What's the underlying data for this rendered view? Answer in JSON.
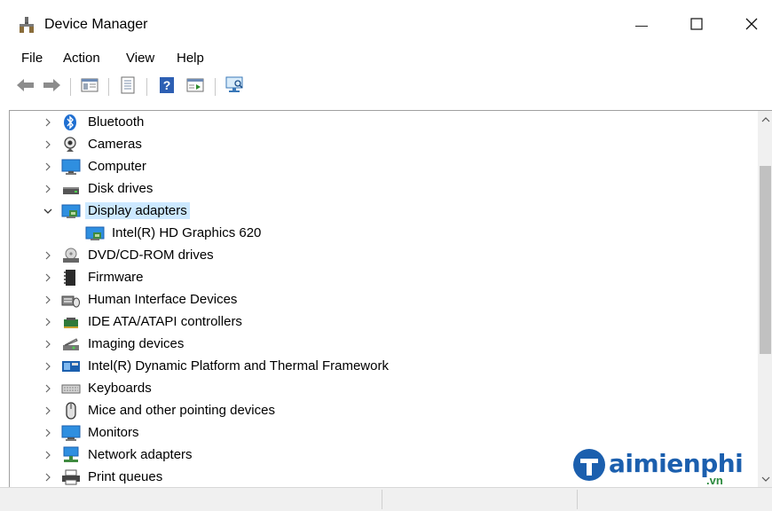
{
  "window": {
    "title": "Device Manager",
    "minimize_glyph": "—",
    "maximize_glyph": "☐",
    "close_glyph": "✕"
  },
  "menu": [
    {
      "label": "File"
    },
    {
      "label": "Action"
    },
    {
      "label": "View"
    },
    {
      "label": "Help"
    }
  ],
  "toolbar": {
    "buttons": [
      "back-icon",
      "forward-icon",
      "show-hide-console-tree-icon",
      "properties-icon",
      "help-icon",
      "run-icon",
      "scan-hardware-icon"
    ]
  },
  "tree": {
    "items": [
      {
        "label": "Bluetooth",
        "icon": "bluetooth-icon",
        "expanded": false
      },
      {
        "label": "Cameras",
        "icon": "camera-icon",
        "expanded": false
      },
      {
        "label": "Computer",
        "icon": "computer-icon",
        "expanded": false
      },
      {
        "label": "Disk drives",
        "icon": "disk-drive-icon",
        "expanded": false
      },
      {
        "label": "Display adapters",
        "icon": "display-adapter-icon",
        "expanded": true,
        "selected": true
      },
      {
        "label": "Intel(R) HD Graphics 620",
        "icon": "display-adapter-icon",
        "child": true
      },
      {
        "label": "DVD/CD-ROM drives",
        "icon": "dvd-drive-icon",
        "expanded": false
      },
      {
        "label": "Firmware",
        "icon": "firmware-icon",
        "expanded": false
      },
      {
        "label": "Human Interface Devices",
        "icon": "hid-icon",
        "expanded": false
      },
      {
        "label": "IDE ATA/ATAPI controllers",
        "icon": "ide-controller-icon",
        "expanded": false
      },
      {
        "label": "Imaging devices",
        "icon": "imaging-device-icon",
        "expanded": false
      },
      {
        "label": "Intel(R) Dynamic Platform and Thermal Framework",
        "icon": "thermal-framework-icon",
        "expanded": false
      },
      {
        "label": "Keyboards",
        "icon": "keyboard-icon",
        "expanded": false
      },
      {
        "label": "Mice and other pointing devices",
        "icon": "mouse-icon",
        "expanded": false
      },
      {
        "label": "Monitors",
        "icon": "monitor-icon",
        "expanded": false
      },
      {
        "label": "Network adapters",
        "icon": "network-adapter-icon",
        "expanded": false
      },
      {
        "label": "Print queues",
        "icon": "printer-icon",
        "expanded": false
      }
    ]
  },
  "watermark": {
    "brand": "aimienphi",
    "suffix": ".vn"
  },
  "colors": {
    "selection": "#cce8ff",
    "watermark_blue": "#1b5fae",
    "watermark_green": "#2b8a3e"
  }
}
